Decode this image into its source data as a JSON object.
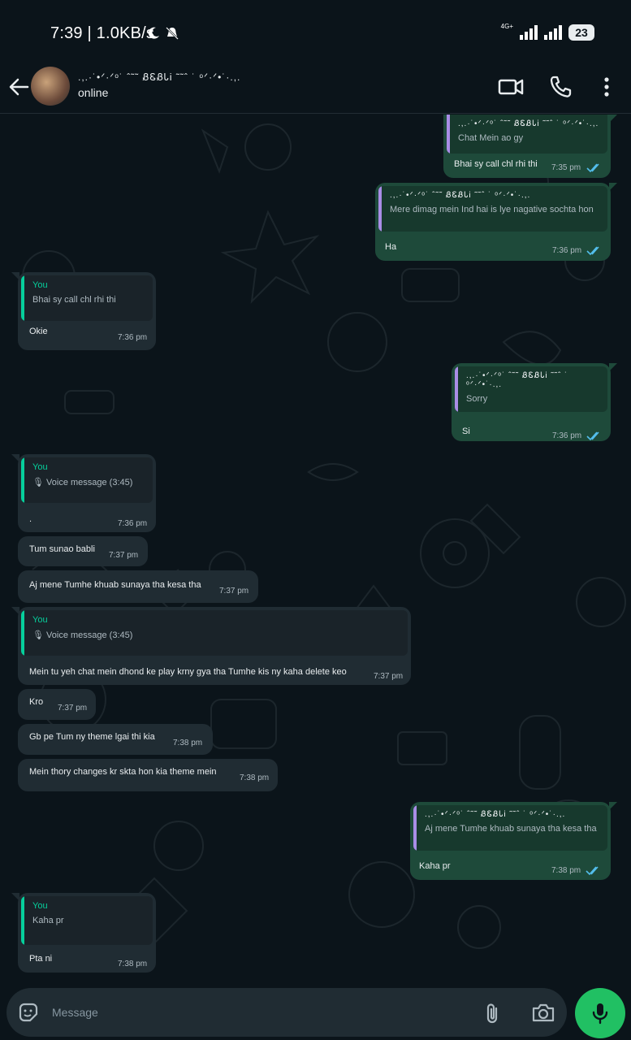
{
  "status_bar": {
    "time": "7:39 | 1.0KB/s",
    "network": "4G+",
    "battery": "23"
  },
  "header": {
    "contact_name": ".,.·˙•ᐟ·ᐟᵒ˙ ˆ˜˜ ᏰᏋᏰᏓᎥ ˜˜ˆ ˙ ᵒᐟ·ᐟ•˙·.,.",
    "status": "online"
  },
  "messages": [
    {
      "dir": "out",
      "quote_author": ".,.·˙•ᐟ·ᐟᵒ˙ ˆ˜˜ ᏰᏋᏰᏓᎥ ˜˜ˆ ˙ ᵒᐟ·ᐟ•˙·.,.",
      "quote_text": "Chat Mein ao gy",
      "text": "Bhai sy call chl rhi thi",
      "time": "7:35 pm"
    },
    {
      "dir": "out",
      "quote_author": ".,.·˙•ᐟ·ᐟᵒ˙ ˆ˜˜ ᏰᏋᏰᏓᎥ ˜˜ˆ ˙ ᵒᐟ·ᐟ•˙·.,.",
      "quote_text": "Mere dimag mein Ind hai is lye nagative sochta hon",
      "text": "Ha",
      "time": "7:36 pm"
    },
    {
      "dir": "in",
      "quote_author": "You",
      "quote_text": "Bhai sy call chl rhi thi",
      "text": "Okie",
      "time": "7:36 pm"
    },
    {
      "dir": "out",
      "quote_author": ".,.·˙•ᐟ·ᐟᵒ˙ ˆ˜˜ ᏰᏋᏰᏓᎥ ˜˜ˆ ˙ ᵒᐟ·ᐟ•˙·.,.",
      "quote_text": "Sorry",
      "text": "Si",
      "time": "7:36 pm"
    },
    {
      "dir": "in",
      "quote_author": "You",
      "quote_text": "🎙 Voice message (3:45)",
      "text": ".",
      "time": "7:36 pm"
    },
    {
      "dir": "in",
      "text": "Tum sunao babli",
      "time": "7:37 pm"
    },
    {
      "dir": "in",
      "text": "Aj mene Tumhe khuab sunaya tha kesa tha",
      "time": "7:37 pm"
    },
    {
      "dir": "in",
      "quote_author": "You",
      "quote_text": "🎙 Voice message (3:45)",
      "text": "Mein tu yeh chat mein dhond ke play krny gya tha Tumhe kis ny kaha delete keo",
      "time": "7:37 pm"
    },
    {
      "dir": "in",
      "text": "Kro",
      "time": "7:37 pm"
    },
    {
      "dir": "in",
      "text": "Gb pe Tum ny theme lgai thi kia",
      "time": "7:38 pm"
    },
    {
      "dir": "in",
      "text": "Mein thory changes kr skta hon kia theme mein",
      "time": "7:38 pm"
    },
    {
      "dir": "out",
      "quote_author": ".,.·˙•ᐟ·ᐟᵒ˙ ˆ˜˜ ᏰᏋᏰᏓᎥ ˜˜ˆ ˙ ᵒᐟ·ᐟ•˙·.,.",
      "quote_text": "Aj mene Tumhe khuab sunaya tha kesa tha",
      "text": "Kaha pr",
      "time": "7:38 pm"
    },
    {
      "dir": "in",
      "quote_author": "You",
      "quote_text": "Kaha pr",
      "text": "Pta ni",
      "time": "7:38 pm"
    }
  ],
  "input": {
    "placeholder": "Message"
  },
  "colors": {
    "background": "#0b141a",
    "incoming": "#202c33",
    "outgoing": "#1e4a3a",
    "accent": "#21c063",
    "read_tick": "#53bdeb"
  }
}
